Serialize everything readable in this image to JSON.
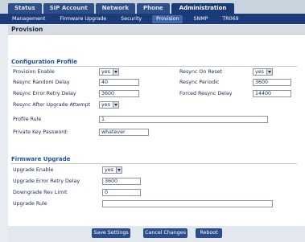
{
  "top_tabs": [
    "Status",
    "SIP Account",
    "Network",
    "Phone",
    "Administration"
  ],
  "sub_tabs": [
    "Management",
    "Firmware Upgrade",
    "Security",
    "Provision",
    "SNMP",
    "TR069"
  ],
  "page_title": "Provision",
  "config_profile": {
    "title": "Configuration Profile",
    "provision_enable_label": "Provision Enable",
    "provision_enable_value": "yes",
    "resync_on_reset_label": "Resync On Reset",
    "resync_on_reset_value": "yes",
    "resync_random_delay_label": "Resync Random Delay",
    "resync_random_delay_value": "40",
    "resync_periodic_label": "Resync Periodic",
    "resync_periodic_value": "3600",
    "resync_error_retry_delay_label": "Resync Error Retry Delay",
    "resync_error_retry_delay_value": "3600",
    "forced_resync_delay_label": "Forced Resync Delay",
    "forced_resync_delay_value": "14400",
    "resync_after_upgrade_label": "Resync After Upgrade Attempt",
    "resync_after_upgrade_value": "yes",
    "profile_rule_label": "Profile Rule",
    "profile_rule_value": "1",
    "private_key_label": "Private Key Password:",
    "private_key_value": "whatever"
  },
  "firmware_upgrade": {
    "title": "Firmware Upgrade",
    "upgrade_enable_label": "Upgrade Enable",
    "upgrade_enable_value": "yes",
    "upgrade_error_retry_delay_label": "Upgrade Error Retry Delay",
    "upgrade_error_retry_delay_value": "3600",
    "downgrade_rev_limit_label": "Downgrade Rev Limit",
    "downgrade_rev_limit_value": "0",
    "upgrade_rule_label": "Upgrade Rule",
    "upgrade_rule_value": ""
  },
  "buttons": {
    "save": "Save Settings",
    "cancel": "Cancel Changes",
    "reboot": "Reboot"
  }
}
